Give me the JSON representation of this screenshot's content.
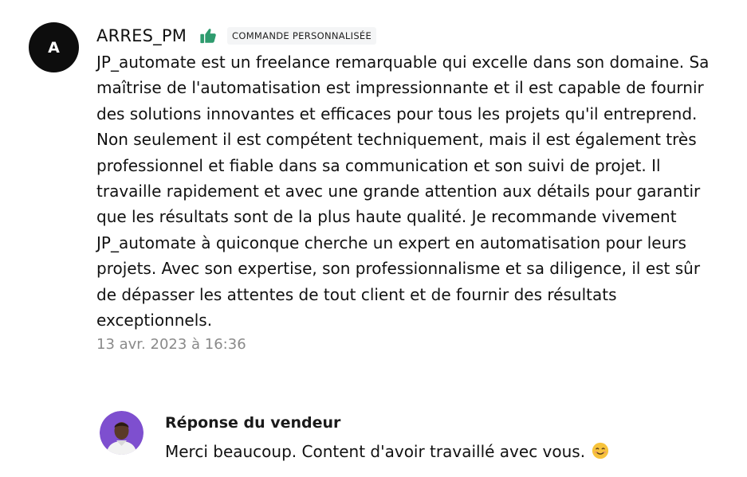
{
  "review": {
    "avatar_letter": "A",
    "username": "ARRES_PM",
    "thumb_icon": "thumbs-up-icon",
    "badge": "COMMANDE PERSONNALISÉE",
    "text": "JP_automate est un freelance remarquable qui excelle dans son domaine. Sa maîtrise de l'automatisation est impressionnante et il est capable de fournir des solutions innovantes et efficaces pour tous les projets qu'il entreprend. Non seulement il est compétent techniquement, mais il est également très professionnel et fiable dans sa communication et son suivi de projet. Il travaille rapidement et avec une grande attention aux détails pour garantir que les résultats sont de la plus haute qualité. Je recommande vivement JP_automate à quiconque cherche un expert en automatisation pour leurs projets. Avec son expertise, son professionnalisme et sa diligence, il est sûr de dépasser les attentes de tout client et de fournir des résultats exceptionnels.",
    "timestamp": "13 avr. 2023 à 16:36"
  },
  "seller_response": {
    "title": "Réponse du vendeur",
    "text": "Merci beaucoup. Content d'avoir travaillé avec vous.",
    "emoji_icon": "smiling-face-emoji-icon"
  },
  "colors": {
    "thumb_green": "#2e9b6e",
    "timestamp_gray": "#8a8a8a",
    "badge_bg": "#f4f5f6",
    "seller_avatar_bg": "#7e4fcf"
  }
}
